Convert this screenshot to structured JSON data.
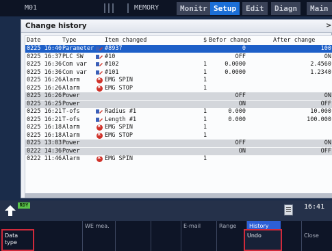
{
  "topbar": {
    "mode": "M01",
    "memory": "MEMORY",
    "tabs": [
      "Monitr",
      "Setup",
      "Edit",
      "Diagn",
      "Main"
    ]
  },
  "dialog": {
    "title": "Change history",
    "close": ">",
    "columns": {
      "date": "Date",
      "type": "Type",
      "item": "Item changed",
      "s": "$",
      "before": "Befor change",
      "after": "After change"
    },
    "rows": [
      {
        "date": "0225 16:40",
        "type": "Parameter",
        "icon": "pen-icon",
        "item": "#8937",
        "s": "",
        "before": "0",
        "after": "100"
      },
      {
        "date": "0225 16:37",
        "type": "PLC SW",
        "icon": "pen-icon",
        "item": "#10",
        "s": "",
        "before": "OFF",
        "after": "ON"
      },
      {
        "date": "0225 16:36",
        "type": "Com var",
        "icon": "pen-icon",
        "item": "#102",
        "s": "1",
        "before": "0.0000",
        "after": "2.4560"
      },
      {
        "date": "0225 16:36",
        "type": "Com var",
        "icon": "pen-icon",
        "item": "#101",
        "s": "1",
        "before": "0.0000",
        "after": "1.2340"
      },
      {
        "date": "0225 16:26",
        "type": "Alarm",
        "icon": "error-icon",
        "item": "EMG  SPIN",
        "s": "1",
        "before": "",
        "after": ""
      },
      {
        "date": "0225 16:26",
        "type": "Alarm",
        "icon": "error-icon",
        "item": "EMG  STOP",
        "s": "1",
        "before": "",
        "after": ""
      },
      {
        "date": "0225 16:26",
        "type": "Power",
        "icon": "",
        "item": "",
        "s": "",
        "before": "OFF",
        "after": "ON"
      },
      {
        "date": "0225 16:25",
        "type": "Power",
        "icon": "",
        "item": "",
        "s": "",
        "before": "ON",
        "after": "OFF"
      },
      {
        "date": "0225 16:21",
        "type": "T-ofs",
        "icon": "pen-icon",
        "item": "Radius #1",
        "s": "1",
        "before": "0.000",
        "after": "10.000"
      },
      {
        "date": "0225 16:21",
        "type": "T-ofs",
        "icon": "pen-icon",
        "item": "Length #1",
        "s": "1",
        "before": "0.000",
        "after": "100.000"
      },
      {
        "date": "0225 16:18",
        "type": "Alarm",
        "icon": "error-icon",
        "item": "EMG  SPIN",
        "s": "1",
        "before": "",
        "after": ""
      },
      {
        "date": "0225 16:18",
        "type": "Alarm",
        "icon": "error-icon",
        "item": "EMG  STOP",
        "s": "1",
        "before": "",
        "after": ""
      },
      {
        "date": "0225 13:03",
        "type": "Power",
        "icon": "",
        "item": "",
        "s": "",
        "before": "OFF",
        "after": "ON"
      },
      {
        "date": "0222 14:36",
        "type": "Power",
        "icon": "",
        "item": "",
        "s": "",
        "before": "ON",
        "after": "OFF"
      },
      {
        "date": "0222 11:46",
        "type": "Alarm",
        "icon": "error-icon",
        "item": "EMG  SPIN",
        "s": "1",
        "before": "",
        "after": ""
      }
    ]
  },
  "status": {
    "ready": "RDY",
    "clock": "16:41"
  },
  "fkeys": [
    {
      "label": "Data\ntype"
    },
    {
      "label": "WE mea."
    },
    {
      "label": ""
    },
    {
      "label": ""
    },
    {
      "label": "E-mail"
    },
    {
      "label": "Range"
    },
    {
      "label": "History"
    },
    {
      "label": "Undo"
    },
    {
      "label": "Close"
    }
  ],
  "colors": {
    "accent": "#1c6fd6",
    "selected_row": "#1d5fc8",
    "error": "#d0322a",
    "ready": "#5bc44a",
    "highlight_outline": "#d12a3b"
  }
}
